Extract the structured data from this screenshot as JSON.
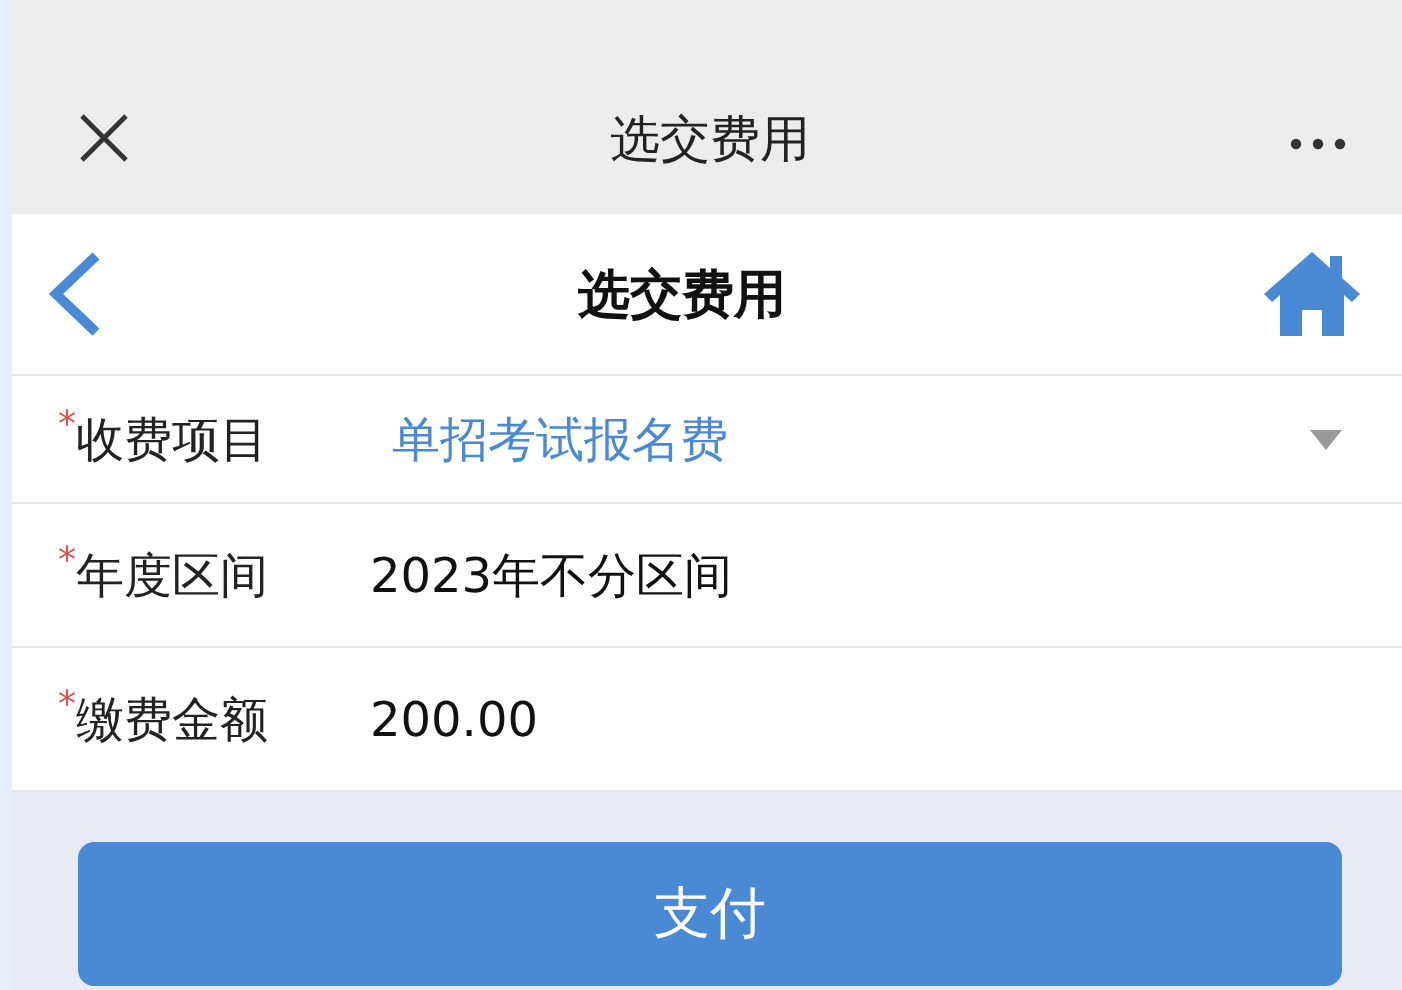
{
  "top_bar": {
    "title": "选交费用"
  },
  "header": {
    "title": "选交费用"
  },
  "fields": [
    {
      "kind": "select",
      "required_mark": "*",
      "label": "收费项目",
      "value": "单招考试报名费"
    },
    {
      "kind": "text",
      "required_mark": "*",
      "label": "年度区间",
      "value": "2023年不分区间"
    },
    {
      "kind": "text",
      "required_mark": "*",
      "label": "缴费金额",
      "value": "200.00"
    }
  ],
  "buttons": [
    {
      "label": "支付"
    }
  ]
}
